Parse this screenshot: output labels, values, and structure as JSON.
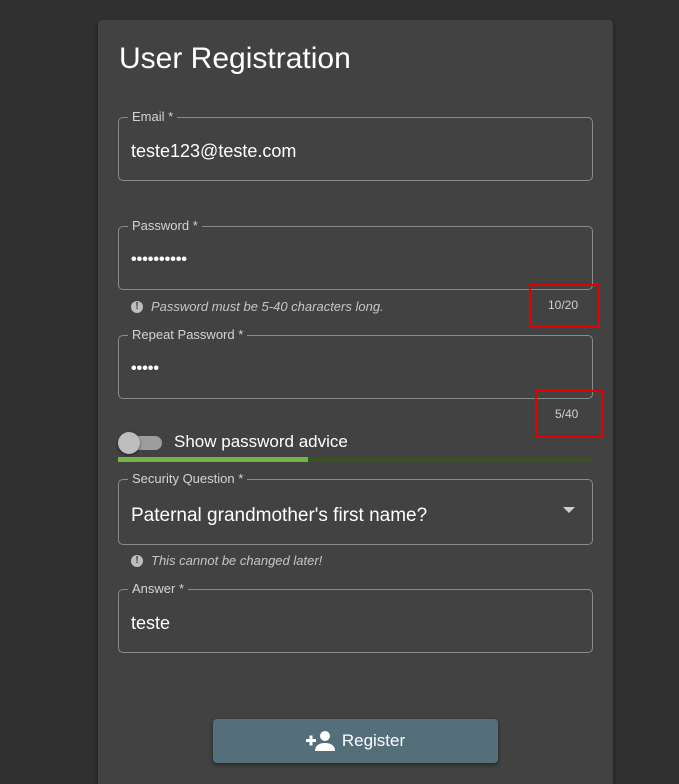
{
  "form": {
    "title": "User Registration"
  },
  "email": {
    "label": "Email *",
    "value": "teste123@teste.com"
  },
  "password": {
    "label": "Password *",
    "value": "••••••••••",
    "hint": "Password must be 5-40 characters long.",
    "counter": "10/20"
  },
  "repeat_password": {
    "label": "Repeat Password *",
    "value": "•••••",
    "counter": "5/40"
  },
  "password_advice": {
    "toggle_label": "Show password advice",
    "enabled": false,
    "strength_fraction": 0.4
  },
  "security_question": {
    "label": "Security Question *",
    "selected": "Paternal grandmother's first name?",
    "hint": "This cannot be changed later!"
  },
  "answer": {
    "label": "Answer *",
    "value": "teste"
  },
  "register": {
    "label": "Register",
    "icon": "person-add-icon"
  },
  "colors": {
    "page_bg": "#303030",
    "card_bg": "#424242",
    "button_bg": "#546e7a",
    "strength_fill": "#74b347",
    "strength_track": "#3b5223",
    "highlight": "#e60000"
  }
}
